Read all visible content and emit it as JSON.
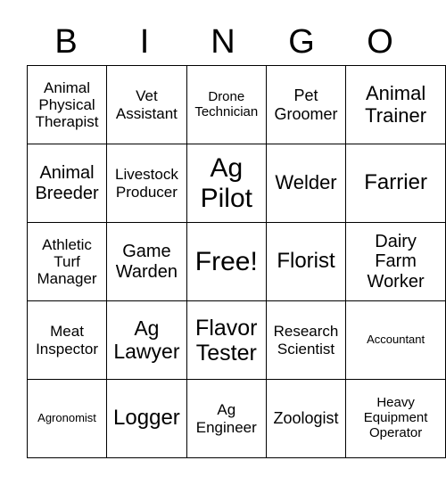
{
  "header": [
    "B",
    "I",
    "N",
    "G",
    "O"
  ],
  "rows": [
    [
      "Animal Physical Therapist",
      "Vet Assistant",
      "Drone Technician",
      "Pet Groomer",
      "Animal Trainer"
    ],
    [
      "Animal Breeder",
      "Livestock Producer",
      "Ag Pilot",
      "Welder",
      "Farrier"
    ],
    [
      "Athletic Turf Manager",
      "Game Warden",
      "Free!",
      "Florist",
      "Dairy Farm Worker"
    ],
    [
      "Meat Inspector",
      "Ag Lawyer",
      "Flavor Tester",
      "Research Scientist",
      "Accountant"
    ],
    [
      "Agronomist",
      "Logger",
      "Ag Engineer",
      "Zoologist",
      "Heavy Equipment Operator"
    ]
  ]
}
